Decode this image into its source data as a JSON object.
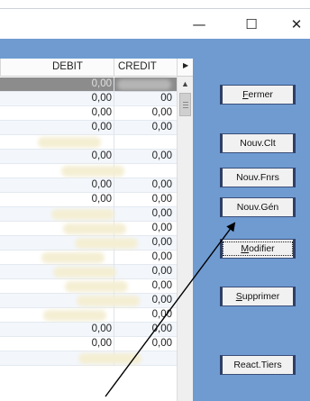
{
  "window": {
    "controls": {
      "minimize": "—",
      "maximize": "☐",
      "close": "✕"
    }
  },
  "grid": {
    "columns": [
      "DEBIT",
      "CREDIT"
    ],
    "rows": [
      {
        "debit": "0,00",
        "credit": "",
        "obscured": true
      },
      {
        "debit": "0,00",
        "credit": "00"
      },
      {
        "debit": "0,00",
        "credit": "0,00"
      },
      {
        "debit": "0,00",
        "credit": "0,00"
      },
      {
        "debit": "",
        "credit": "",
        "obscured": true
      },
      {
        "debit": "0,00",
        "credit": "0,00"
      },
      {
        "debit": "",
        "credit": "",
        "obscured": true
      },
      {
        "debit": "0,00",
        "credit": "0,00"
      },
      {
        "debit": "0,00",
        "credit": "0,00"
      },
      {
        "debit": "",
        "credit": "0,00",
        "obscured": true
      },
      {
        "debit": "",
        "credit": "0,00",
        "obscured": true
      },
      {
        "debit": "",
        "credit": "0,00",
        "obscured": true
      },
      {
        "debit": "",
        "credit": "0,00",
        "obscured": true
      },
      {
        "debit": "",
        "credit": "0,00",
        "obscured": true
      },
      {
        "debit": "",
        "credit": "0,00",
        "obscured": true
      },
      {
        "debit": "",
        "credit": "0,00",
        "obscured": true
      },
      {
        "debit": "",
        "credit": "0,00",
        "obscured": true
      },
      {
        "debit": "0,00",
        "credit": "0,00"
      },
      {
        "debit": "0,00",
        "credit": "0,00"
      },
      {
        "debit": "",
        "credit": "",
        "obscured": true
      }
    ]
  },
  "buttons": {
    "fermer": {
      "first": "F",
      "rest": "ermer"
    },
    "nouv_clt": "Nouv.Clt",
    "nouv_fnrs": "Nouv.Fnrs",
    "nouv_gen": "Nouv.Gén",
    "modifier": {
      "first": "M",
      "rest": "odifier"
    },
    "supprimer": {
      "first": "S",
      "rest": "upprimer"
    },
    "react_tiers": "React.Tiers"
  },
  "colors": {
    "panel": "#6f9bd1",
    "selected_row": "#8c8c8c",
    "annotation": "#000000"
  }
}
